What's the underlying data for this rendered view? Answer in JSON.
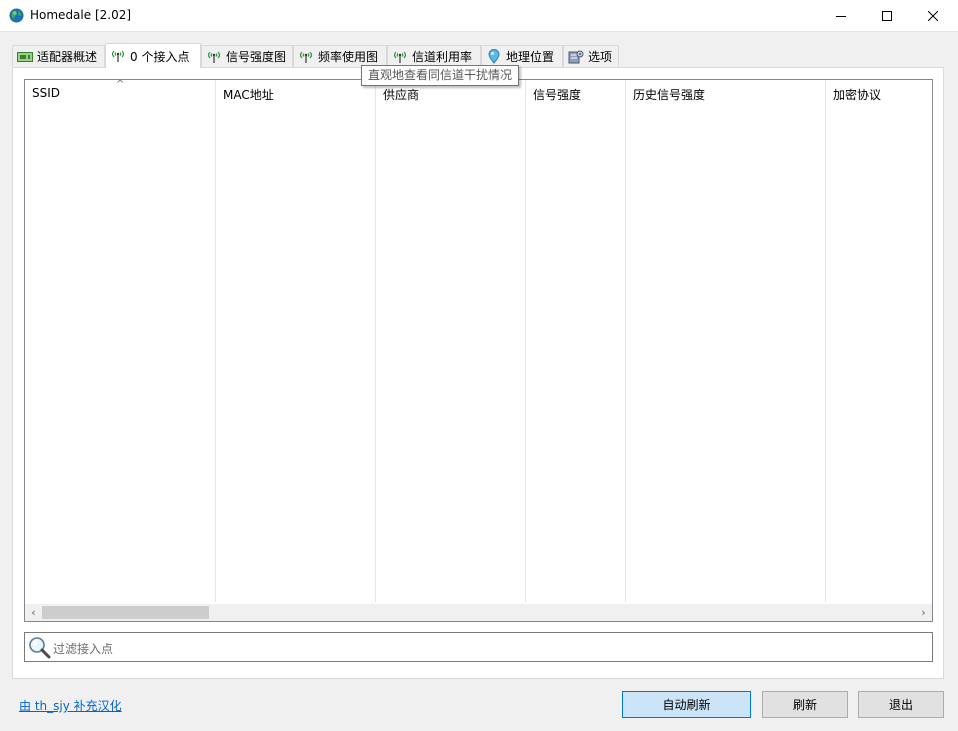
{
  "window": {
    "title": "Homedale [2.02]"
  },
  "tabs": [
    {
      "label": "适配器概述",
      "icon": "adapter-icon"
    },
    {
      "label": "0 个接入点",
      "icon": "antenna-icon"
    },
    {
      "label": "信号强度图",
      "icon": "antenna-icon"
    },
    {
      "label": "频率使用图",
      "icon": "antenna-icon"
    },
    {
      "label": "信道利用率",
      "icon": "antenna-icon"
    },
    {
      "label": "地理位置",
      "icon": "location-pin-icon"
    },
    {
      "label": "选项",
      "icon": "options-icon"
    }
  ],
  "active_tab": "0 个接入点",
  "tooltip": "直观地查看同信道干扰情况",
  "table": {
    "columns": [
      "SSID",
      "MAC地址",
      "供应商",
      "信号强度",
      "历史信号强度",
      "加密协议"
    ],
    "rows": []
  },
  "filter": {
    "placeholder": "过滤接入点"
  },
  "footer": {
    "credit": "由 th_sjy 补充汉化",
    "auto_refresh": "自动刷新",
    "refresh": "刷新",
    "exit": "退出"
  },
  "colors": {
    "accent": "#0078d7",
    "link": "#0066cc",
    "primary_button_bg": "#cce4f7"
  }
}
